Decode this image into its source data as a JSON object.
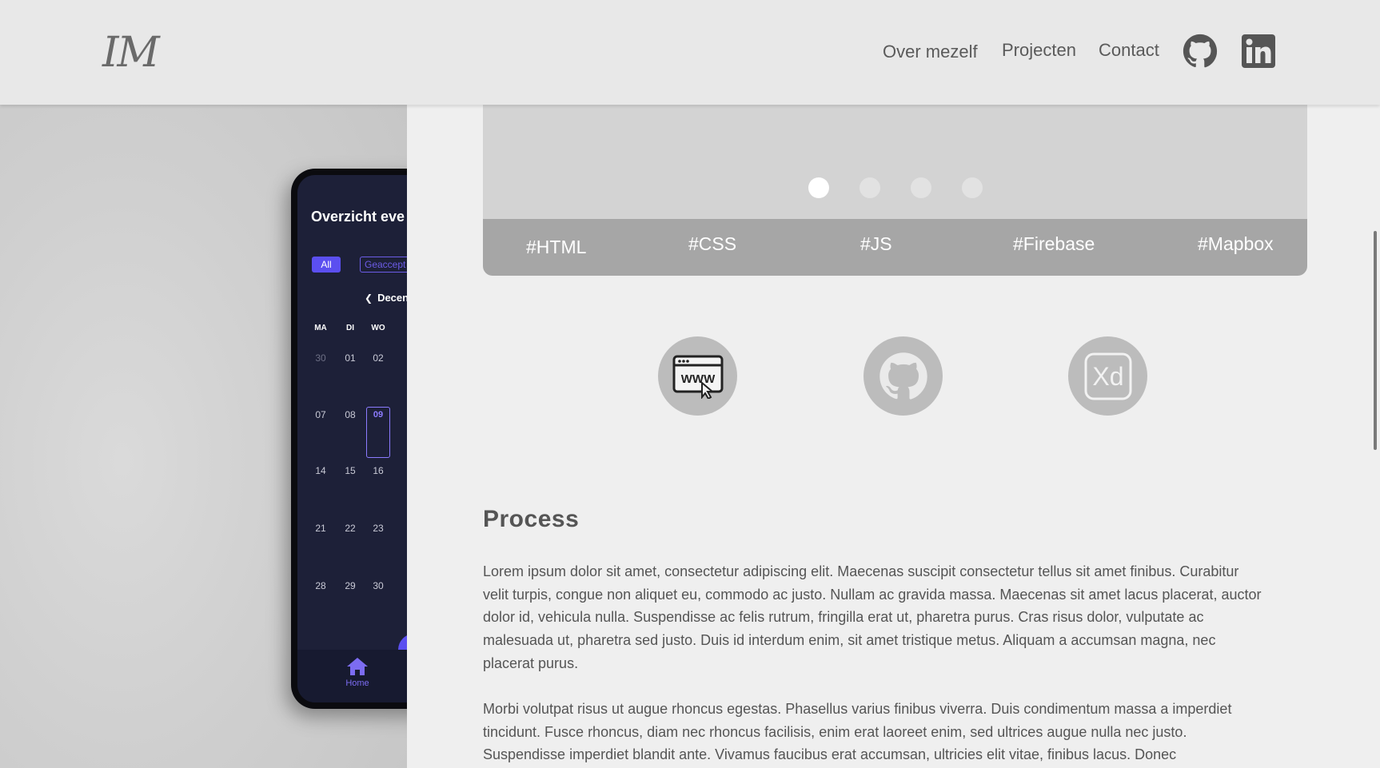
{
  "header": {
    "logo": "IM",
    "nav": [
      "Over mezelf",
      "Projecten",
      "Contact"
    ],
    "icons": [
      "github-icon",
      "linkedin-icon"
    ]
  },
  "phone_mockup": {
    "title": "Overzicht eve",
    "filters": [
      "All",
      "Geaccept"
    ],
    "month": "Decen",
    "weekdays": [
      "MA",
      "DI",
      "WO"
    ],
    "weeks": [
      [
        "30",
        "01",
        "02"
      ],
      [
        "07",
        "08",
        "09"
      ],
      [
        "14",
        "15",
        "16"
      ],
      [
        "21",
        "22",
        "23"
      ],
      [
        "28",
        "29",
        "30"
      ]
    ],
    "selected_day": "09",
    "tab_home": "Home"
  },
  "carousel": {
    "slide_count": 4,
    "active_index": 0,
    "tags": [
      "#HTML",
      "#CSS",
      "#JS",
      "#Firebase",
      "#Mapbox"
    ]
  },
  "links": [
    "website-icon",
    "github-icon",
    "adobe-xd-icon"
  ],
  "process": {
    "title": "Process",
    "paragraphs": [
      "Lorem ipsum dolor sit amet, consectetur adipiscing elit. Maecenas suscipit consectetur tellus sit amet finibus. Curabitur velit turpis, congue non aliquet eu, commodo ac justo. Nullam ac gravida massa. Maecenas sit amet lacus placerat, auctor dolor id, vehicula nulla. Suspendisse ac felis rutrum, fringilla erat ut, pharetra purus. Cras risus dolor, vulputate ac malesuada ut, pharetra sed justo. Duis id interdum enim, sit amet tristique metus. Aliquam a accumsan magna, nec placerat purus.",
      "Morbi volutpat risus ut augue rhoncus egestas. Phasellus varius finibus viverra. Duis condimentum massa a imperdiet tincidunt. Fusce rhoncus, diam nec rhoncus facilisis, enim erat laoreet enim, sed ultrices augue nulla nec justo. Suspendisse imperdiet blandit ante. Vivamus faucibus erat accumsan, ultricies elit vitae, finibus lacus. Donec"
    ]
  },
  "colors": {
    "accent": "#5b4ff0",
    "tagbar": "#a6a6a6",
    "header_bg": "#e8e8e8",
    "panel_bg": "#efefef",
    "text": "#555555"
  }
}
